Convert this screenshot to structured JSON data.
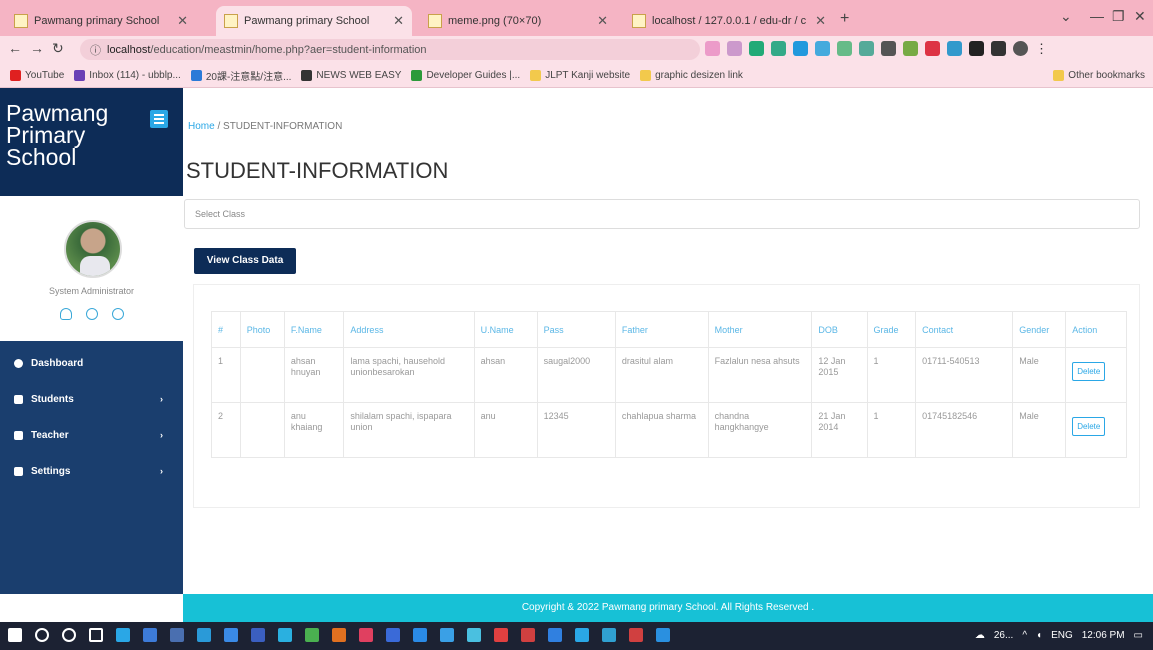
{
  "browser": {
    "tabs": [
      {
        "title": "Pawmang primary School"
      },
      {
        "title": "Pawmang primary School"
      },
      {
        "title": "meme.png (70×70)"
      },
      {
        "title": "localhost / 127.0.0.1 / edu-dr / c"
      }
    ],
    "new_tab": "+",
    "url_host": "localhost",
    "url_path": "/education/meastmin/home.php?aer=student-information",
    "bookmarks": [
      "YouTube",
      "Inbox (114) - ubblp...",
      "20課-注意點/注意...",
      "NEWS WEB EASY",
      "Developer Guides |...",
      "JLPT Kanji website",
      "graphic desizen link"
    ],
    "other_bookmarks": "Other bookmarks"
  },
  "sidebar": {
    "brand": "Pawmang Primary School",
    "role": "System Administrator",
    "items": [
      {
        "label": "Dashboard",
        "has_caret": false
      },
      {
        "label": "Students",
        "has_caret": true
      },
      {
        "label": "Teacher",
        "has_caret": true
      },
      {
        "label": "Settings",
        "has_caret": true
      }
    ],
    "caret": "›"
  },
  "main": {
    "breadcrumb_home": "Home",
    "breadcrumb_sep": "/",
    "breadcrumb_current": "STUDENT-INFORMATION",
    "title": "STUDENT-INFORMATION",
    "select_placeholder": "Select Class",
    "view_button": "View Class Data",
    "table": {
      "columns": [
        "#",
        "Photo",
        "F.Name",
        "Address",
        "U.Name",
        "Pass",
        "Father",
        "Mother",
        "DOB",
        "Grade",
        "Contact",
        "Gender",
        "Action"
      ],
      "rows": [
        [
          "1",
          "",
          "ahsan hnuyan",
          "lama spachi, hausehold unionbesarokan",
          "ahsan",
          "saugal2000",
          "drasitul alam",
          "Fazlalun nesa ahsuts",
          "12 Jan 2015",
          "1",
          "01711-540513",
          "Male",
          "Delete"
        ],
        [
          "2",
          "",
          "anu khaiang",
          "shilalam spachi, ispapara union",
          "anu",
          "12345",
          "chahlapua sharma",
          "chandna hangkhangye",
          "21 Jan 2014",
          "1",
          "01745182546",
          "Male",
          "Delete"
        ]
      ]
    }
  },
  "footer": "Copyright & 2022 Pawmang primary School. All Rights Reserved .",
  "taskbar": {
    "tray_text": "26...",
    "lang": "ENG",
    "time": "12:06 PM"
  }
}
